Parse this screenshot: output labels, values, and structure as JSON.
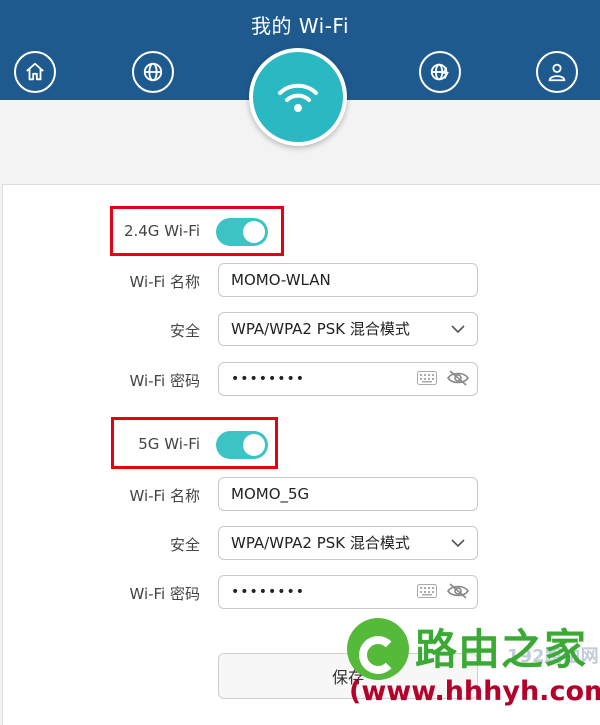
{
  "header": {
    "title": "我的 Wi-Fi",
    "nav": [
      {
        "icon": "home-icon"
      },
      {
        "icon": "globe-icon"
      },
      {
        "icon": "wifi-icon",
        "active": true
      },
      {
        "icon": "globe-settings-icon"
      },
      {
        "icon": "user-icon"
      }
    ]
  },
  "wifi24": {
    "toggle_label": "2.4G Wi-Fi",
    "enabled": true,
    "name_label": "Wi-Fi 名称",
    "name_value": "MOMO-WLAN",
    "security_label": "安全",
    "security_value": "WPA/WPA2 PSK 混合模式",
    "password_label": "Wi-Fi 密码",
    "password_value": "••••••••"
  },
  "wifi5": {
    "toggle_label": "5G Wi-Fi",
    "enabled": true,
    "name_label": "Wi-Fi 名称",
    "name_value": "MOMO_5G",
    "security_label": "安全",
    "security_value": "WPA/WPA2 PSK 混合模式",
    "password_label": "Wi-Fi 密码",
    "password_value": "••••••••"
  },
  "save_label": "保存",
  "watermark": {
    "title": "路由之家",
    "url": "(www.hhhyh.com)",
    "faint": "192路由网"
  },
  "colors": {
    "header": "#1f5a8f",
    "accent": "#3cc3c5",
    "highlight": "#e60012"
  }
}
